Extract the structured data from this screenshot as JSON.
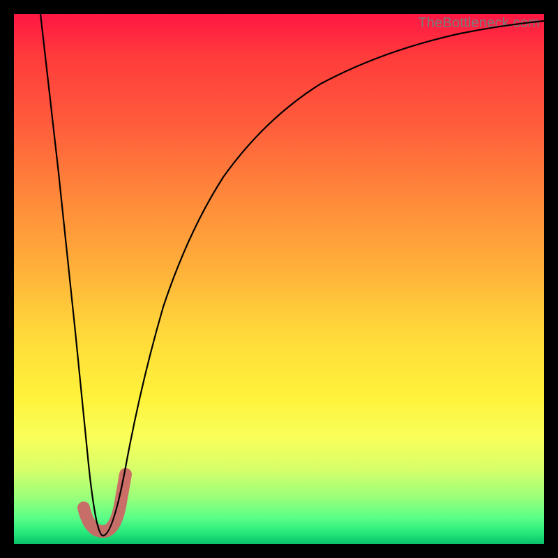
{
  "attribution": "TheBottleneck.com",
  "colors": {
    "frame": "#000000",
    "gradient_top": "#ff1744",
    "gradient_mid1": "#ff8a3a",
    "gradient_mid2": "#fff23a",
    "gradient_bottom": "#0ac06a",
    "curve": "#000000",
    "highlight": "#cc6666"
  },
  "chart_data": {
    "type": "line",
    "title": "",
    "xlabel": "",
    "ylabel": "",
    "xlim": [
      0,
      100
    ],
    "ylim": [
      0,
      100
    ],
    "grid": false,
    "legend": false,
    "series": [
      {
        "name": "bottleneck-curve",
        "x": [
          5,
          8,
          11,
          13.5,
          16,
          18,
          20,
          23,
          27,
          32,
          38,
          46,
          56,
          68,
          82,
          100
        ],
        "y": [
          100,
          70,
          40,
          15,
          2,
          4,
          12,
          28,
          45,
          60,
          72,
          82,
          89,
          94,
          97,
          99
        ]
      }
    ],
    "annotation": {
      "name": "sweet-spot-J",
      "x_range": [
        12,
        20
      ],
      "y_range": [
        0,
        16
      ],
      "description": "Highlighted J-shaped minimum region near the curve's lowest point"
    }
  }
}
